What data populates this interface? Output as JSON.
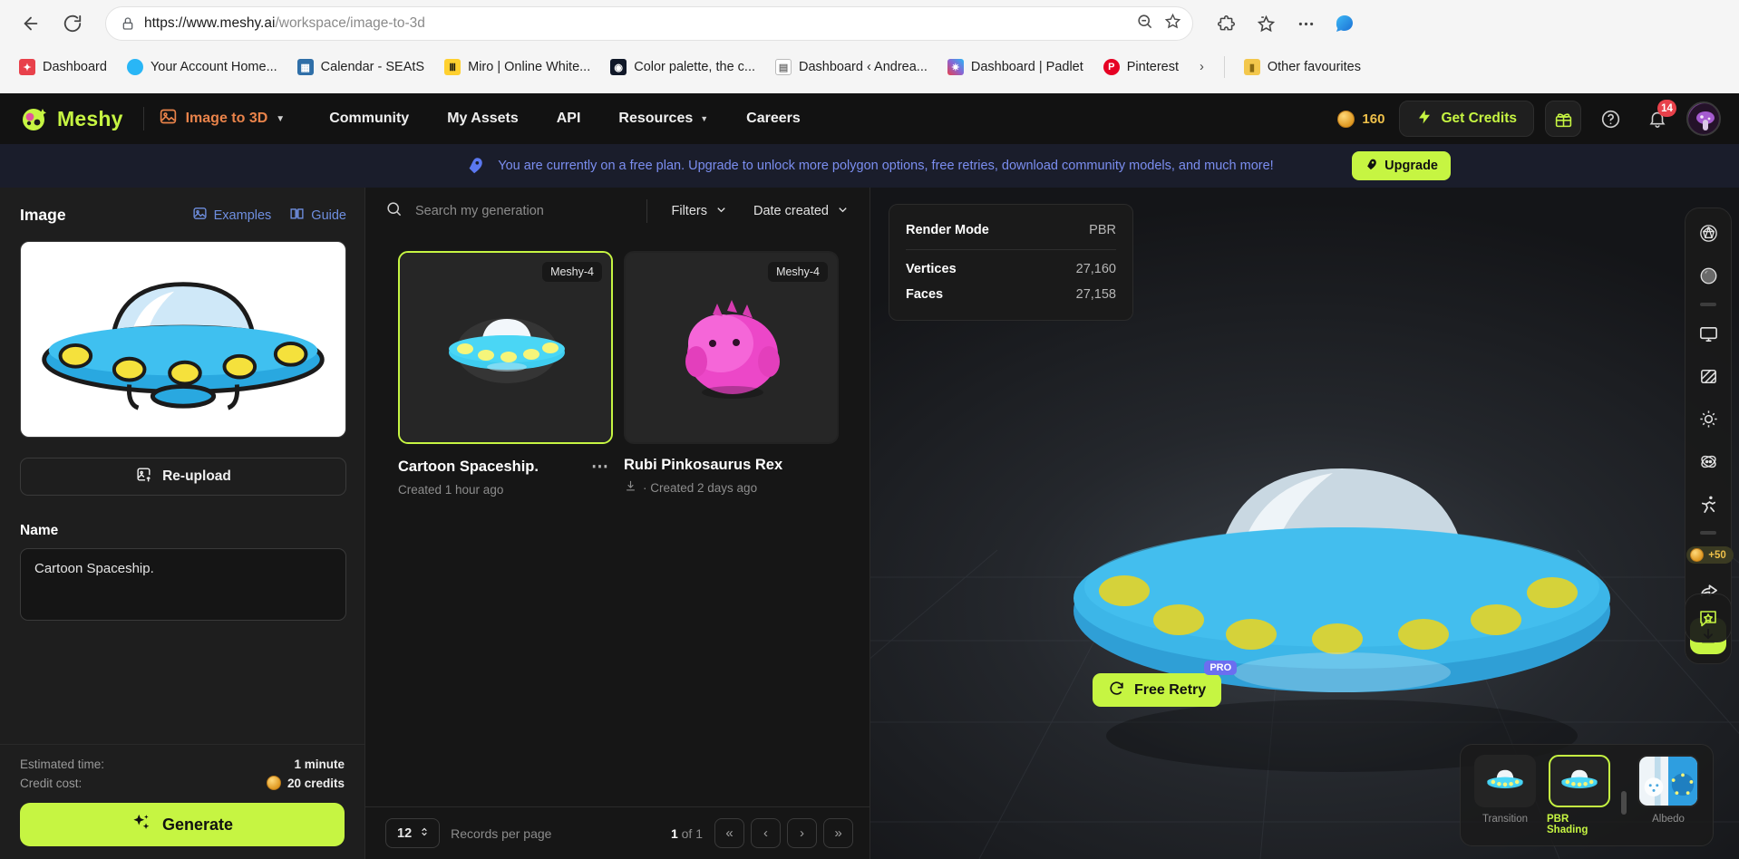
{
  "browser": {
    "back_label": "Back",
    "reload_label": "Reload",
    "url_secure": "https://www.meshy.ai",
    "url_path": "/workspace/image-to-3d",
    "url_full": "https://www.meshy.ai/workspace/image-to-3d",
    "bookmarks": [
      {
        "label": "Dashboard",
        "icon": "dashboard-favicon",
        "color": "#e8414b"
      },
      {
        "label": "Your Account Home...",
        "icon": "account-favicon",
        "color": "#29b6f6"
      },
      {
        "label": "Calendar - SEAtS",
        "icon": "calendar-favicon",
        "color": "#2f6fa8"
      },
      {
        "label": "Miro | Online White...",
        "icon": "miro-favicon",
        "color": "#ffd02f"
      },
      {
        "label": "Color palette, the c...",
        "icon": "color-palette-favicon",
        "color": "#101828"
      },
      {
        "label": "Dashboard ‹ Andrea...",
        "icon": "page-favicon",
        "color": "#f1f1f1"
      },
      {
        "label": "Dashboard | Padlet",
        "icon": "padlet-favicon",
        "color": "#8a63d2"
      },
      {
        "label": "Pinterest",
        "icon": "pinterest-favicon",
        "color": "#e60023"
      }
    ],
    "overflow_label": "›",
    "other_favourites": "Other favourites"
  },
  "topnav": {
    "brand": "Meshy",
    "mode": "Image to 3D",
    "links": [
      "Community",
      "My Assets",
      "API",
      "Resources",
      "Careers"
    ],
    "credits_value": "160",
    "get_credits": "Get Credits",
    "notification_count": "14"
  },
  "banner": {
    "message": "You are currently on a free plan. Upgrade to unlock more polygon options, free retries, download community models, and much more!",
    "cta": "Upgrade"
  },
  "left_panel": {
    "title": "Image",
    "examples": "Examples",
    "guide": "Guide",
    "reupload": "Re-upload",
    "name_label": "Name",
    "name_value": "Cartoon Spaceship.",
    "estimated_time_label": "Estimated time:",
    "estimated_time_value": "1 minute",
    "credit_cost_label": "Credit cost:",
    "credit_cost_value": "20 credits",
    "generate": "Generate"
  },
  "mid_panel": {
    "search_placeholder": "Search my generation",
    "filters": "Filters",
    "date_created": "Date created",
    "cards": [
      {
        "title": "Cartoon Spaceship.",
        "chip": "Meshy-4",
        "subtitle": "Created 1 hour ago",
        "selected": true,
        "downloaded": false
      },
      {
        "title": "Rubi Pinkosaurus Rex",
        "chip": "Meshy-4",
        "subtitle": "· Created 2 days ago",
        "selected": false,
        "downloaded": true
      }
    ],
    "pager": {
      "records_per_page_value": "12",
      "records_per_page_label": "Records per page",
      "current_page": "1",
      "of_label": "of",
      "total_pages": "1",
      "first_label": "«",
      "prev_label": "‹",
      "next_label": "›",
      "last_label": "»"
    }
  },
  "viewer": {
    "info": [
      {
        "key": "Render Mode",
        "value": "PBR"
      },
      {
        "key": "Vertices",
        "value": "27,160"
      },
      {
        "key": "Faces",
        "value": "27,158"
      }
    ],
    "free_retry": "Free Retry",
    "pro_badge": "PRO",
    "thumbstrip": [
      {
        "label": "Transition",
        "active": false
      },
      {
        "label": "PBR Shading",
        "active": true
      },
      {
        "label": "Albedo",
        "active": false
      }
    ],
    "rail": [
      {
        "name": "wireframe-sphere-icon"
      },
      {
        "name": "material-sphere-icon"
      },
      {
        "name": "separator"
      },
      {
        "name": "display-icon"
      },
      {
        "name": "texture-icon"
      },
      {
        "name": "lighting-icon"
      },
      {
        "name": "physics-icon"
      },
      {
        "name": "animate-icon"
      }
    ],
    "reward_label": "+50",
    "share_label": "Share",
    "download_label": "Download",
    "feedback_label": "Feedback"
  },
  "colors": {
    "accent": "#c6f542",
    "brand_orange": "#e9834a",
    "banner_text": "#7b8ef0",
    "pro_blue": "#6b6ef0",
    "badge_red": "#e8414b",
    "coin_gold": "#eec04a"
  }
}
